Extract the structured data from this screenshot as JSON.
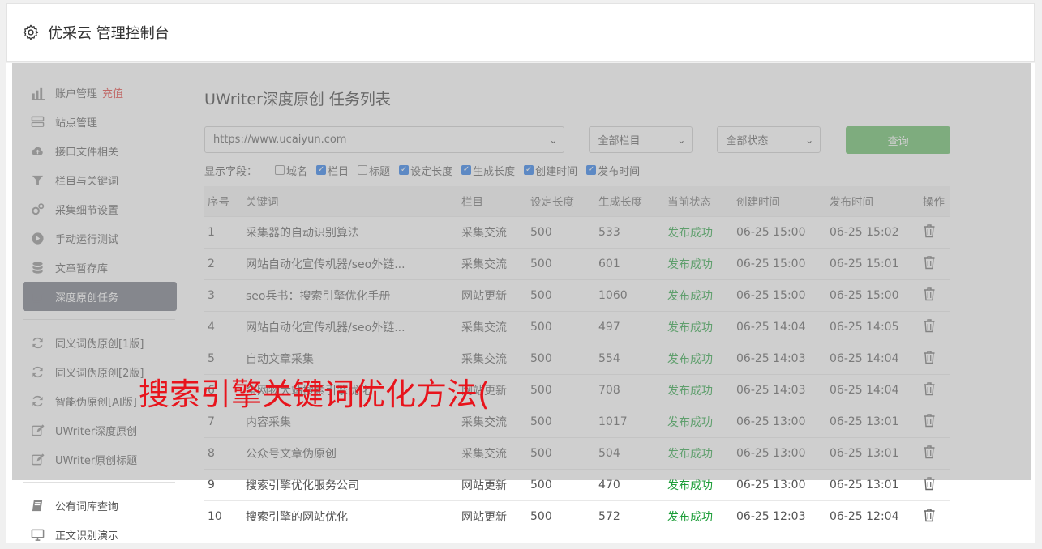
{
  "header": {
    "title": "优采云 管理控制台"
  },
  "sidebar": {
    "items": [
      {
        "label": "账户管理",
        "extra": "充值",
        "icon": "bar-chart-icon"
      },
      {
        "label": "站点管理",
        "icon": "server-icon"
      },
      {
        "label": "接口文件相关",
        "icon": "cloud-upload-icon"
      },
      {
        "label": "栏目与关键词",
        "icon": "filter-icon"
      },
      {
        "label": "采集细节设置",
        "icon": "gears-icon"
      },
      {
        "label": "手动运行测试",
        "icon": "play-circle-icon"
      },
      {
        "label": "文章暂存库",
        "icon": "database-icon"
      },
      {
        "label": "深度原创任务",
        "icon": "edit-icon",
        "active": true
      },
      {
        "label": "同义词伪原创[1版]",
        "icon": "refresh-icon"
      },
      {
        "label": "同义词伪原创[2版]",
        "icon": "refresh-icon"
      },
      {
        "label": "智能伪原创[AI版]",
        "icon": "refresh-icon"
      },
      {
        "label": "UWriter深度原创",
        "icon": "edit-icon"
      },
      {
        "label": "UWriter原创标题",
        "icon": "edit-icon"
      },
      {
        "label": "公有词库查询",
        "icon": "book-icon"
      },
      {
        "label": "正文识别演示",
        "icon": "monitor-icon"
      }
    ]
  },
  "main": {
    "title": "UWriter深度原创 任务列表",
    "site_select": "https://www.ucaiyun.com",
    "column_select": "全部栏目",
    "status_select": "全部状态",
    "query_label": "查询",
    "fields_label": "显示字段：",
    "fields": [
      {
        "label": "域名",
        "checked": false
      },
      {
        "label": "栏目",
        "checked": true
      },
      {
        "label": "标题",
        "checked": false
      },
      {
        "label": "设定长度",
        "checked": true
      },
      {
        "label": "生成长度",
        "checked": true
      },
      {
        "label": "创建时间",
        "checked": true
      },
      {
        "label": "发布时间",
        "checked": true
      }
    ],
    "columns": [
      "序号",
      "关键词",
      "栏目",
      "设定长度",
      "生成长度",
      "当前状态",
      "创建时间",
      "发布时间",
      "操作"
    ],
    "rows": [
      [
        "1",
        "采集器的自动识别算法",
        "采集交流",
        "500",
        "533",
        "发布成功",
        "06-25 15:00",
        "06-25 15:02"
      ],
      [
        "2",
        "网站自动化宣传机器/seo外链...",
        "采集交流",
        "500",
        "601",
        "发布成功",
        "06-25 15:00",
        "06-25 15:01"
      ],
      [
        "3",
        "seo兵书：搜索引擎优化手册",
        "网站更新",
        "500",
        "1060",
        "发布成功",
        "06-25 15:00",
        "06-25 15:00"
      ],
      [
        "4",
        "网站自动化宣传机器/seo外链...",
        "采集交流",
        "500",
        "497",
        "发布成功",
        "06-25 14:04",
        "06-25 14:05"
      ],
      [
        "5",
        "自动文章采集",
        "采集交流",
        "500",
        "554",
        "发布成功",
        "06-25 14:03",
        "06-25 14:04"
      ],
      [
        "6",
        "全网物大站搜索引擎优化",
        "网站更新",
        "500",
        "708",
        "发布成功",
        "06-25 14:03",
        "06-25 14:04"
      ],
      [
        "7",
        "内容采集",
        "采集交流",
        "500",
        "1017",
        "发布成功",
        "06-25 13:00",
        "06-25 13:01"
      ],
      [
        "8",
        "公众号文章伪原创",
        "采集交流",
        "500",
        "504",
        "发布成功",
        "06-25 13:00",
        "06-25 13:01"
      ],
      [
        "9",
        "搜索引擎优化服务公司",
        "网站更新",
        "500",
        "470",
        "发布成功",
        "06-25 13:00",
        "06-25 13:01"
      ],
      [
        "10",
        "搜索引擎的网站优化",
        "网站更新",
        "500",
        "572",
        "发布成功",
        "06-25 12:03",
        "06-25 12:04"
      ]
    ]
  },
  "watermark": "搜索引擎关键词优化方法(",
  "colors": {
    "accent_green": "#5cb85c",
    "status_green": "#1e9e3a",
    "active_bg": "#6b6e7a",
    "watermark": "#e8141c",
    "recharge": "#e0302d"
  }
}
